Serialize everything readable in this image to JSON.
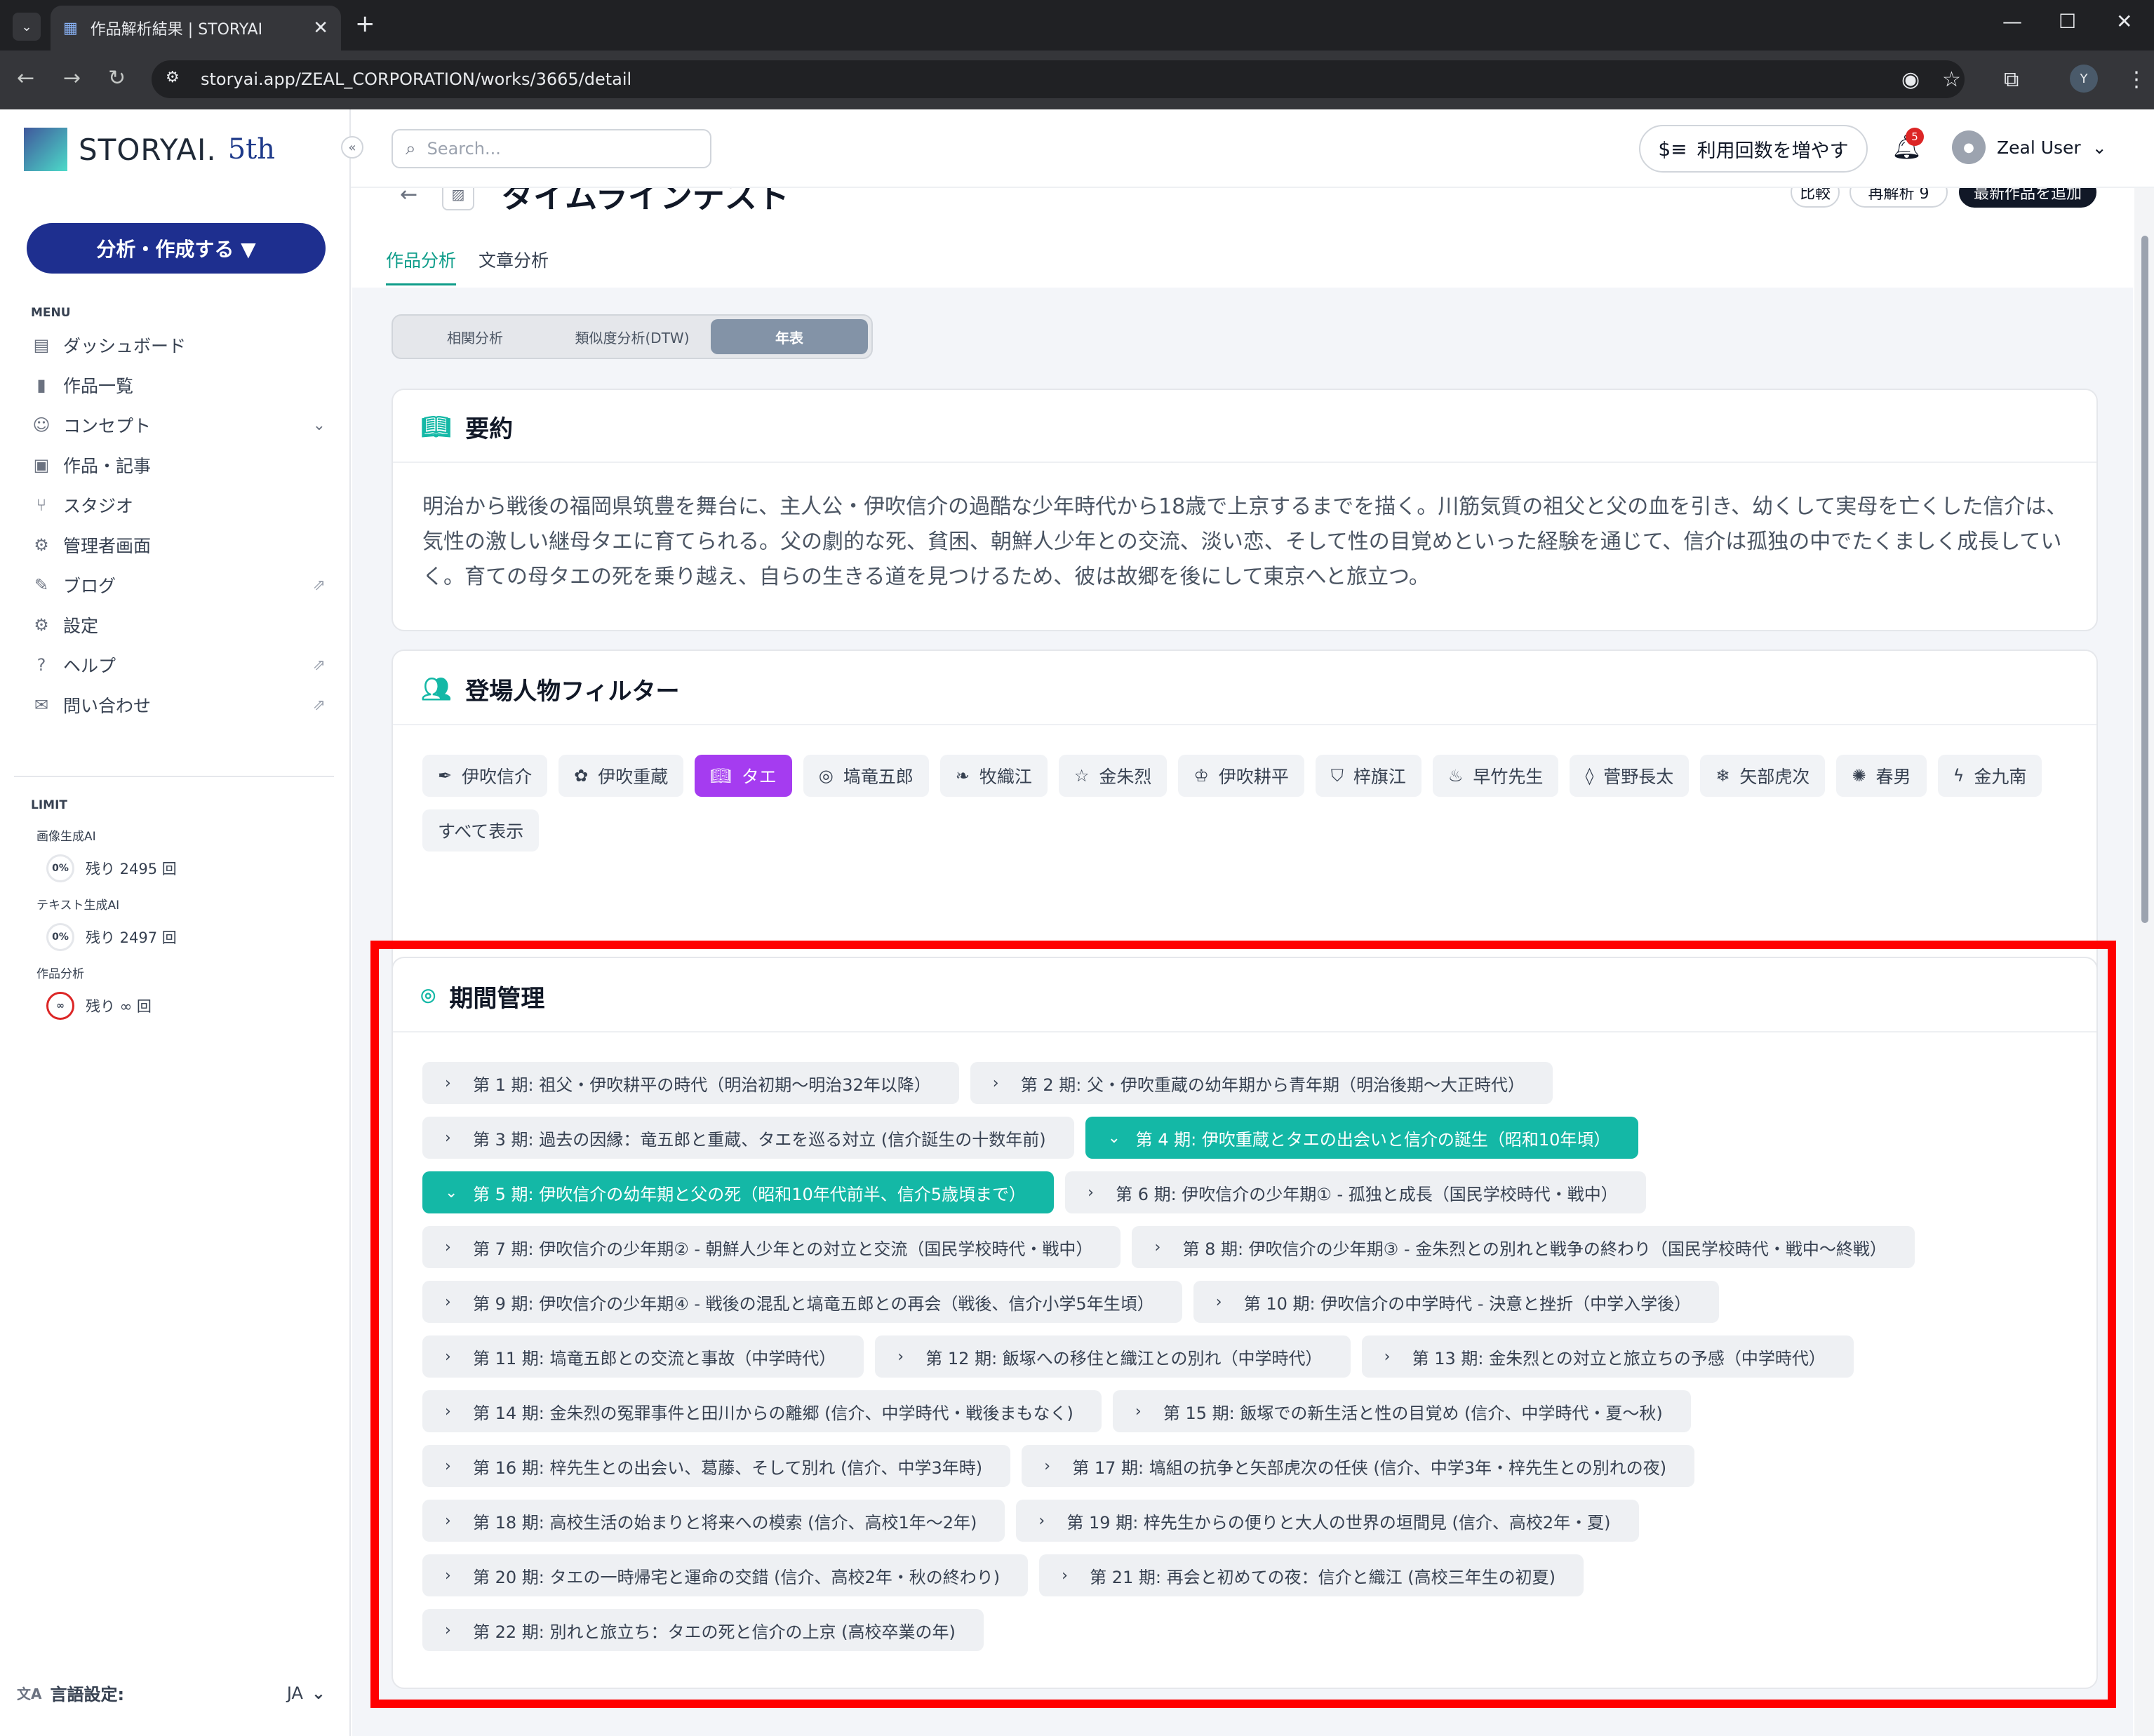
{
  "browser": {
    "tab_title": "作品解析結果 | STORYAI",
    "url": "storyai.app/ZEAL_CORPORATION/works/3665/detail",
    "profile_initial": "Y"
  },
  "sidebar": {
    "logo_text": "STORYAI.",
    "logo_badge": "5th",
    "collapse": "«",
    "analyze_button": "分析・作成する ▼",
    "menu_heading": "MENU",
    "items": [
      {
        "label": "ダッシュボード",
        "icon": "dashboard-icon"
      },
      {
        "label": "作品一覧",
        "icon": "document-icon"
      },
      {
        "label": "コンセプト",
        "icon": "smile-icon"
      },
      {
        "label": "作品・記事",
        "icon": "article-icon"
      },
      {
        "label": "スタジオ",
        "icon": "branch-icon"
      },
      {
        "label": "管理者画面",
        "icon": "gear-icon"
      },
      {
        "label": "ブログ",
        "icon": "edit-icon"
      },
      {
        "label": "設定",
        "icon": "gear-icon"
      },
      {
        "label": "ヘルプ",
        "icon": "help-icon"
      },
      {
        "label": "問い合わせ",
        "icon": "mail-icon"
      }
    ],
    "limit_heading": "LIMIT",
    "limits": [
      {
        "title": "画像生成AI",
        "percent": "0%",
        "remaining": "残り 2495 回"
      },
      {
        "title": "テキスト生成AI",
        "percent": "0%",
        "remaining": "残り 2497 回"
      },
      {
        "title": "作品分析",
        "percent": "∞",
        "remaining": "残り ∞ 回"
      }
    ],
    "language_label": "言語設定:",
    "language_value": "JA"
  },
  "header": {
    "search_placeholder": "Search...",
    "boost_button": "利用回数を増やす",
    "notification_count": "5",
    "user_name": "Zeal User"
  },
  "page": {
    "title": "タイムラインテスト",
    "buttons": [
      "比較",
      "再解析 9",
      "最新作品を追加"
    ],
    "tabs": [
      "作品分析",
      "文章分析"
    ],
    "active_tab": 0,
    "segments": [
      "相関分析",
      "類似度分析(DTW)",
      "年表"
    ],
    "active_segment": 2
  },
  "summary": {
    "heading": "要約",
    "text": "明治から戦後の福岡県筑豊を舞台に、主人公・伊吹信介の過酷な少年時代から18歳で上京するまでを描く。川筋気質の祖父と父の血を引き、幼くして実母を亡くした信介は、気性の激しい継母タエに育てられる。父の劇的な死、貧困、朝鮮人少年との交流、淡い恋、そして性の目覚めといった経験を通じて、信介は孤独の中でたくましく成長していく。育ての母タエの死を乗り越え、自らの生きる道を見つけるため、彼は故郷を後にして東京へと旅立つ。"
  },
  "character_filter": {
    "heading": "登場人物フィルター",
    "characters": [
      {
        "name": "伊吹信介",
        "icon": "feather-icon",
        "active": false
      },
      {
        "name": "伊吹重蔵",
        "icon": "flower-icon",
        "active": false
      },
      {
        "name": "タエ",
        "icon": "book-icon",
        "active": true
      },
      {
        "name": "塙竜五郎",
        "icon": "user-circle-icon",
        "active": false
      },
      {
        "name": "牧織江",
        "icon": "leaf-icon",
        "active": false
      },
      {
        "name": "金朱烈",
        "icon": "star-icon",
        "active": false
      },
      {
        "name": "伊吹耕平",
        "icon": "crown-icon",
        "active": false
      },
      {
        "name": "梓旗江",
        "icon": "shield-icon",
        "active": false
      },
      {
        "name": "早竹先生",
        "icon": "flame-icon",
        "active": false
      },
      {
        "name": "菅野長太",
        "icon": "drop-icon",
        "active": false
      },
      {
        "name": "矢部虎次",
        "icon": "snowflake-icon",
        "active": false
      },
      {
        "name": "春男",
        "icon": "bug-icon",
        "active": false
      },
      {
        "name": "金九南",
        "icon": "bolt-icon",
        "active": false
      }
    ],
    "show_all": "すべて表示"
  },
  "period_management": {
    "heading": "期間管理",
    "periods": [
      {
        "label": "第 1 期: 祖父・伊吹耕平の時代（明治初期〜明治32年以降）",
        "expanded": false
      },
      {
        "label": "第 2 期: 父・伊吹重蔵の幼年期から青年期（明治後期〜大正時代）",
        "expanded": false
      },
      {
        "label": "第 3 期: 過去の因縁：竜五郎と重蔵、タエを巡る対立 (信介誕生の十数年前)",
        "expanded": false
      },
      {
        "label": "第 4 期: 伊吹重蔵とタエの出会いと信介の誕生（昭和10年頃）",
        "expanded": true
      },
      {
        "label": "第 5 期: 伊吹信介の幼年期と父の死（昭和10年代前半、信介5歳頃まで）",
        "expanded": true
      },
      {
        "label": "第 6 期: 伊吹信介の少年期① - 孤独と成長（国民学校時代・戦中）",
        "expanded": false
      },
      {
        "label": "第 7 期: 伊吹信介の少年期② - 朝鮮人少年との対立と交流（国民学校時代・戦中）",
        "expanded": false
      },
      {
        "label": "第 8 期: 伊吹信介の少年期③ - 金朱烈との別れと戦争の終わり（国民学校時代・戦中〜終戦）",
        "expanded": false
      },
      {
        "label": "第 9 期: 伊吹信介の少年期④ - 戦後の混乱と塙竜五郎との再会（戦後、信介小学5年生頃）",
        "expanded": false
      },
      {
        "label": "第 10 期: 伊吹信介の中学時代 - 決意と挫折（中学入学後）",
        "expanded": false
      },
      {
        "label": "第 11 期: 塙竜五郎との交流と事故（中学時代）",
        "expanded": false
      },
      {
        "label": "第 12 期: 飯塚への移住と織江との別れ（中学時代）",
        "expanded": false
      },
      {
        "label": "第 13 期: 金朱烈との対立と旅立ちの予感（中学時代）",
        "expanded": false
      },
      {
        "label": "第 14 期: 金朱烈の冤罪事件と田川からの離郷 (信介、中学時代・戦後まもなく)",
        "expanded": false
      },
      {
        "label": "第 15 期: 飯塚での新生活と性の目覚め (信介、中学時代・夏〜秋)",
        "expanded": false
      },
      {
        "label": "第 16 期: 梓先生との出会い、葛藤、そして別れ (信介、中学3年時)",
        "expanded": false
      },
      {
        "label": "第 17 期: 塙組の抗争と矢部虎次の任侠 (信介、中学3年・梓先生との別れの夜)",
        "expanded": false
      },
      {
        "label": "第 18 期: 高校生活の始まりと将来への模索 (信介、高校1年〜2年)",
        "expanded": false
      },
      {
        "label": "第 19 期: 梓先生からの便りと大人の世界の垣間見 (信介、高校2年・夏)",
        "expanded": false
      },
      {
        "label": "第 20 期: タエの一時帰宅と運命の交錯 (信介、高校2年・秋の終わり)",
        "expanded": false
      },
      {
        "label": "第 21 期: 再会と初めての夜：信介と織江 (高校三年生の初夏)",
        "expanded": false
      },
      {
        "label": "第 22 期: 別れと旅立ち：タエの死と信介の上京 (高校卒業の年)",
        "expanded": false
      }
    ]
  },
  "colors": {
    "accent_teal": "#14b8a6",
    "active_chip": "#a53cf0",
    "primary_navy": "#1e2f8f",
    "highlight_red": "#ff0000"
  }
}
